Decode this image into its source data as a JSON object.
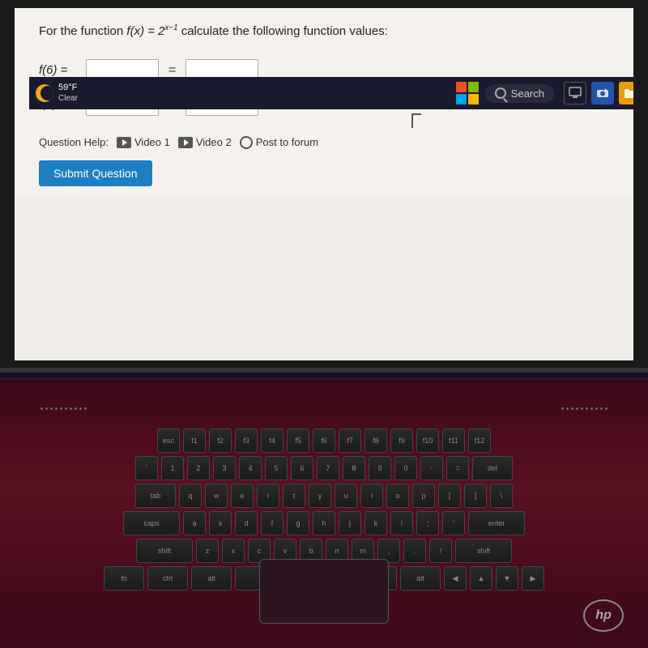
{
  "screen": {
    "problem_text_before": "For the function",
    "function_name": "f(x)",
    "equals": "=",
    "formula": "2",
    "exponent": "x−1",
    "problem_text_after": "calculate the following function values:",
    "f6_label": "f(6) =",
    "f8_label": "f(8) =",
    "input_placeholder": "",
    "equals_sign": "=",
    "cursor_symbol": "↖"
  },
  "question_help": {
    "label": "Question Help:",
    "video1_label": "Video 1",
    "video2_label": "Video 2",
    "post_label": "Post to forum"
  },
  "submit_button": {
    "label": "Submit Question"
  },
  "taskbar": {
    "weather_temp": "59°F",
    "weather_desc": "Clear",
    "search_label": "Search"
  },
  "hp_logo": "hp"
}
